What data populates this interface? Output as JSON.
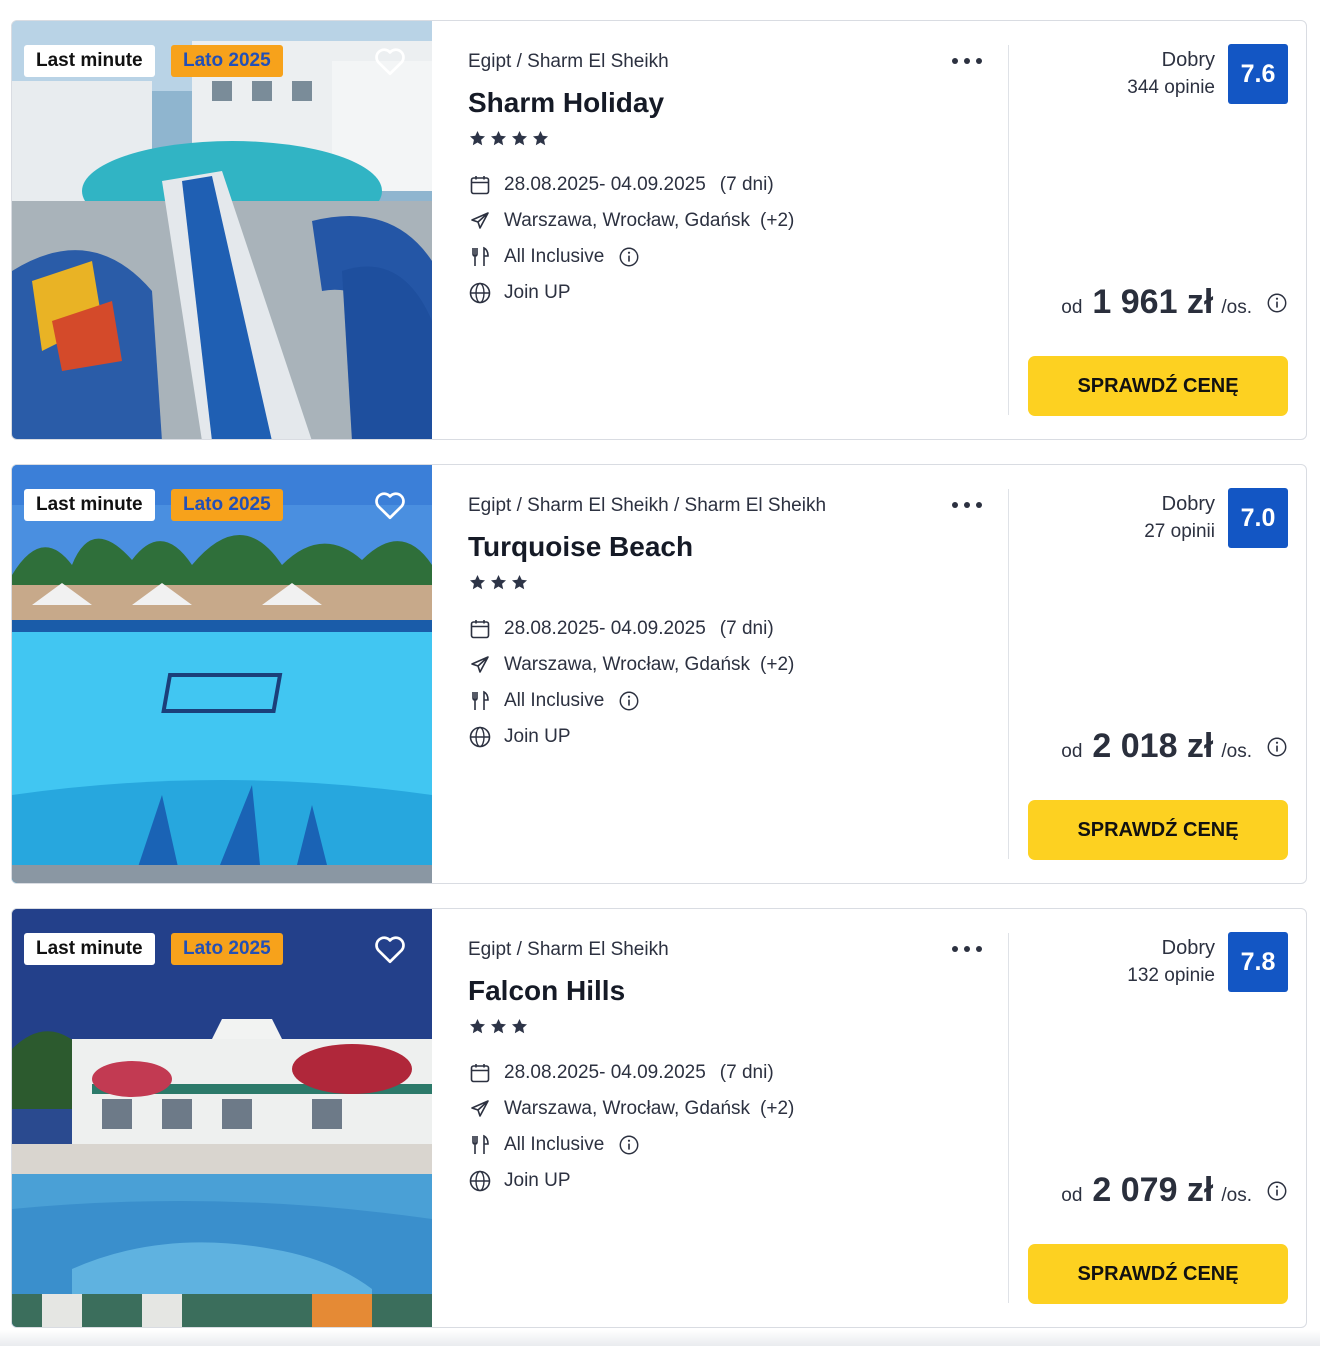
{
  "colors": {
    "score_bg": "#1356c4",
    "cta_bg": "#fdd121",
    "season_badge_bg": "#f7a21b",
    "season_badge_text": "#2350b6",
    "star": "#2d3447"
  },
  "offers": [
    {
      "badges": {
        "last_minute": "Last minute",
        "season": "Lato 2025"
      },
      "breadcrumb": {
        "country": "Egipt",
        "sep1": "/",
        "region": "Sharm El Sheikh",
        "sep2": "",
        "city": ""
      },
      "name": "Sharm Holiday",
      "stars": 4,
      "dates": "28.08.2025- 04.09.2025",
      "duration": "(7 dni)",
      "departures": "Warszawa, Wrocław, Gdańsk",
      "departures_more": "(+2)",
      "board": "All Inclusive",
      "operator": "Join UP",
      "rating_label": "Dobry",
      "rating_count": "344 opinie",
      "score": "7.6",
      "price_prefix": "od",
      "price": "1 961 zł",
      "price_unit": "/os.",
      "cta": "SPRAWDŹ CENĘ",
      "photo_icon": "water-park-photo"
    },
    {
      "badges": {
        "last_minute": "Last minute",
        "season": "Lato 2025"
      },
      "breadcrumb": {
        "country": "Egipt",
        "sep1": "/",
        "region": "Sharm El Sheikh",
        "sep2": "/",
        "city": "Sharm El Sheikh"
      },
      "name": "Turquoise Beach",
      "stars": 3,
      "dates": "28.08.2025- 04.09.2025",
      "duration": "(7 dni)",
      "departures": "Warszawa, Wrocław, Gdańsk",
      "departures_more": "(+2)",
      "board": "All Inclusive",
      "operator": "Join UP",
      "rating_label": "Dobry",
      "rating_count": "27 opinii",
      "score": "7.0",
      "price_prefix": "od",
      "price": "2 018 zł",
      "price_unit": "/os.",
      "cta": "SPRAWDŹ CENĘ",
      "photo_icon": "pool-photo"
    },
    {
      "badges": {
        "last_minute": "Last minute",
        "season": "Lato 2025"
      },
      "breadcrumb": {
        "country": "Egipt",
        "sep1": "/",
        "region": "Sharm El Sheikh",
        "sep2": "",
        "city": ""
      },
      "name": "Falcon Hills",
      "stars": 3,
      "dates": "28.08.2025- 04.09.2025",
      "duration": "(7 dni)",
      "departures": "Warszawa, Wrocław, Gdańsk",
      "departures_more": "(+2)",
      "board": "All Inclusive",
      "operator": "Join UP",
      "rating_label": "Dobry",
      "rating_count": "132 opinie",
      "score": "7.8",
      "price_prefix": "od",
      "price": "2 079 zł",
      "price_unit": "/os.",
      "cta": "SPRAWDŹ CENĘ",
      "photo_icon": "hotel-pool-photo"
    }
  ]
}
